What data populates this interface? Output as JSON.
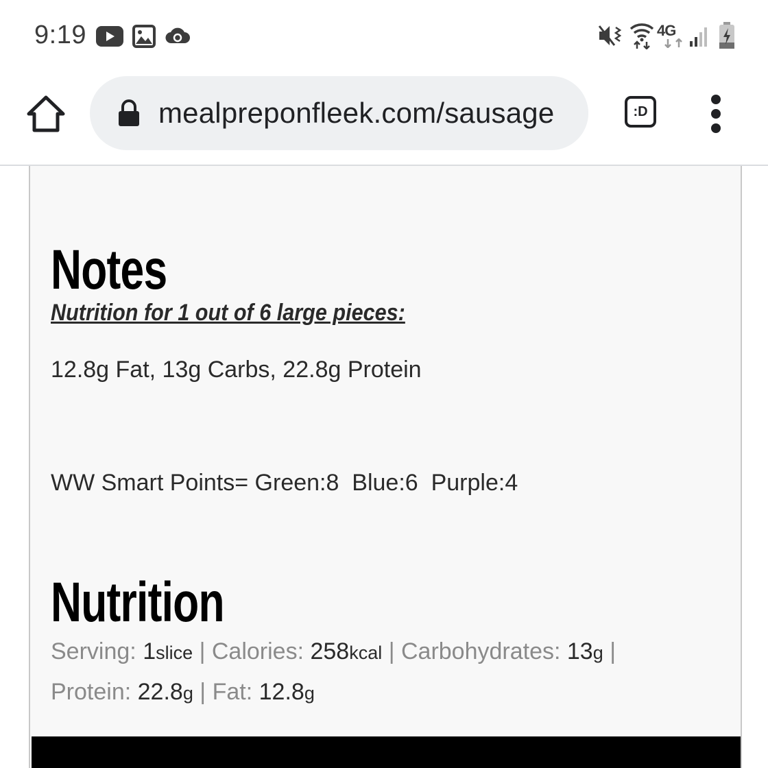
{
  "status_bar": {
    "time": "9:19",
    "left_icons": [
      "youtube-icon",
      "gallery-icon",
      "cloud-sync-icon"
    ],
    "right_icons": [
      "mute-vibrate-icon",
      "wifi-icon",
      "4g-lte-icon",
      "signal-icon",
      "battery-charging-icon"
    ],
    "network": "4G"
  },
  "browser": {
    "url": "mealpreponfleek.com/sausage",
    "tabs_label": ":D"
  },
  "notes": {
    "heading": "Notes",
    "subtitle": "Nutrition for 1 out of 6 large pieces:",
    "macros": "12.8g Fat, 13g Carbs, 22.8g Protein",
    "ww_points": "WW Smart Points= Green:8  Blue:6  Purple:4"
  },
  "nutrition": {
    "heading": "Nutrition",
    "serving_label": "Serving: ",
    "serving_value": "1",
    "serving_unit": "slice",
    "calories_label": "Calories: ",
    "calories_value": "258",
    "calories_unit": "kcal",
    "carbs_label": "Carbohydrates: ",
    "carbs_value": "13",
    "carbs_unit": "g",
    "protein_label": "Protein: ",
    "protein_value": "22.8",
    "protein_unit": "g",
    "fat_label": "Fat: ",
    "fat_value": "12.8",
    "fat_unit": "g",
    "separator": "|"
  }
}
